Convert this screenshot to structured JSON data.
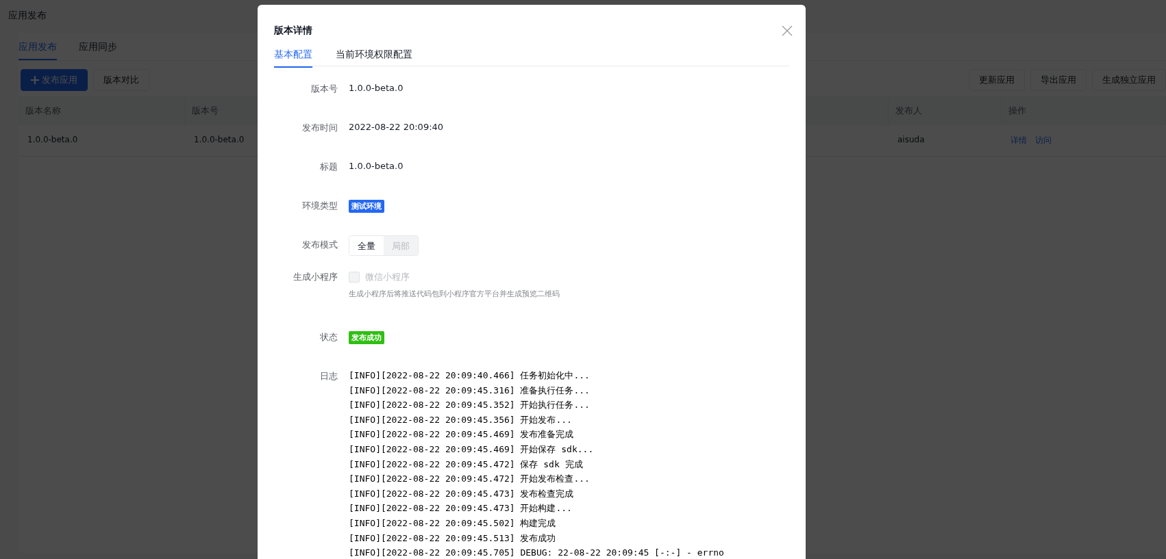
{
  "page": {
    "title": "应用发布"
  },
  "tabs": [
    {
      "label": "应用发布",
      "selected": true
    },
    {
      "label": "应用同步",
      "selected": false
    }
  ],
  "toolbar": {
    "left_buttons": [
      {
        "label": "发布应用",
        "kind": "primary"
      },
      {
        "label": "版本对比",
        "kind": "default"
      }
    ],
    "right_buttons": [
      {
        "label": "更新应用"
      },
      {
        "label": "导出应用"
      },
      {
        "label": "生成独立应用"
      }
    ]
  },
  "table": {
    "columns": [
      "版本名称",
      "版本号",
      "发布人",
      "操作"
    ],
    "rows": [
      {
        "version_name": "1.0.0-beta.0",
        "version": "1.0.0-beta.0",
        "publisher": "aisuda",
        "actions": [
          "详情",
          "访问"
        ]
      }
    ]
  },
  "dialog": {
    "title": "版本详情",
    "tabs": [
      {
        "label": "基本配置",
        "selected": true
      },
      {
        "label": "当前环境权限配置",
        "selected": false
      }
    ],
    "fields": [
      {
        "kind": "text",
        "label": "版本号",
        "value": "1.0.0-beta.0"
      },
      {
        "kind": "text",
        "label": "发布时间",
        "value": "2022-08-22 20:09:40"
      },
      {
        "kind": "text",
        "label": "标题",
        "value": "1.0.0-beta.0"
      },
      {
        "kind": "tag",
        "label": "环境类型",
        "value": "测试环境",
        "color": "#2468f2"
      },
      {
        "kind": "segmented",
        "label": "发布模式",
        "options": [
          {
            "label": "全量",
            "selected": true
          },
          {
            "label": "局部",
            "selected": false
          }
        ]
      },
      {
        "kind": "checkbox",
        "label": "生成小程序",
        "value": "微信小程序",
        "checked": false,
        "disabled": true,
        "hint": "生成小程序后将推送代码包到小程序官方平台并生成预览二维码"
      },
      {
        "kind": "tag",
        "label": "状态",
        "value": "发布成功",
        "color": "#30bf13"
      },
      {
        "kind": "log",
        "label": "日志",
        "lines": [
          "[INFO][2022-08-22 20:09:40.466] 任务初始化中...",
          "[INFO][2022-08-22 20:09:45.316] 准备执行任务...",
          "[INFO][2022-08-22 20:09:45.352] 开始执行任务...",
          "[INFO][2022-08-22 20:09:45.356] 开始发布...",
          "[INFO][2022-08-22 20:09:45.469] 发布准备完成",
          "[INFO][2022-08-22 20:09:45.469] 开始保存 sdk...",
          "[INFO][2022-08-22 20:09:45.472] 保存 sdk 完成",
          "[INFO][2022-08-22 20:09:45.472] 开始发布检查...",
          "[INFO][2022-08-22 20:09:45.473] 发布检查完成",
          "[INFO][2022-08-22 20:09:45.473] 开始构建...",
          "[INFO][2022-08-22 20:09:45.502] 构建完成",
          "[INFO][2022-08-22 20:09:45.513] 发布成功",
          "[INFO][2022-08-22 20:09:45.705] DEBUG: 22-08-22 20:09:45 [-:-] - errno"
        ]
      }
    ]
  }
}
